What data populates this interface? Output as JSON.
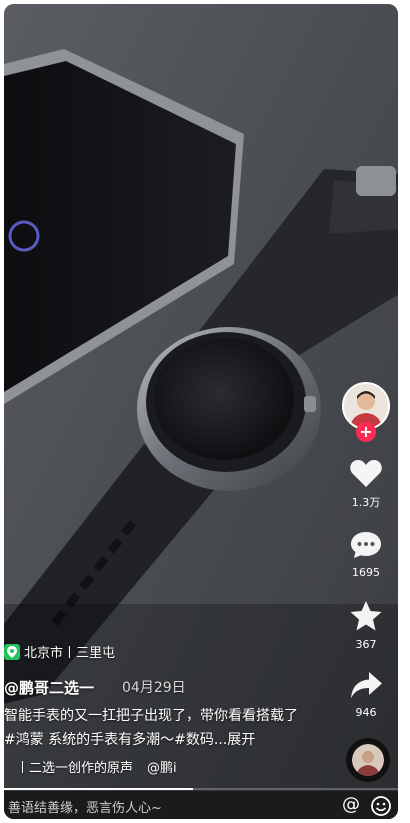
{
  "rail": {
    "like_count": "1.3万",
    "comment_count": "1695",
    "favorite_count": "367",
    "share_count": "946"
  },
  "info": {
    "location": "北京市丨三里屯",
    "author": "@鹏哥二选一",
    "date": "04月29日",
    "description": "智能手表的又一扛把子出现了，带你看看搭载了#鸿蒙 系统的手表有多潮～#数码...展开",
    "music": "丨二选一创作的原声",
    "music_author": "@鹏i"
  },
  "progress": 0.48,
  "comment": {
    "placeholder": "善语结善缘，恶言伤人心~"
  },
  "icons": {
    "like": "heart-icon",
    "comment": "comment-bubble-icon",
    "favorite": "star-icon",
    "share": "share-arrow-icon",
    "location": "location-icon",
    "at": "at-icon",
    "emoji": "emoji-icon"
  },
  "colors": {
    "accent": "#fe2c55",
    "location_badge": "#22c25f"
  }
}
